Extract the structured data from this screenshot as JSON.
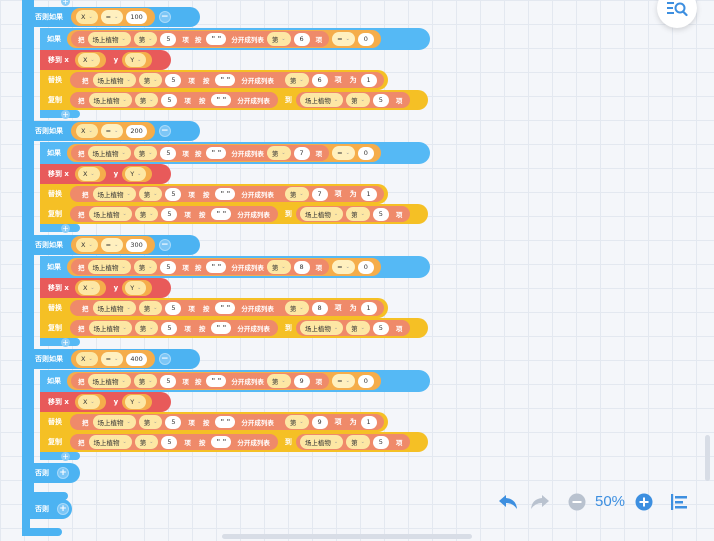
{
  "labels": {
    "else_if": "否则如果",
    "if": "如果",
    "move_to_x": "移到 x",
    "y": "y",
    "replace": "替换",
    "copy": "复制",
    "else": "否则",
    "take": "把",
    "item_word": "项",
    "split_by": "按",
    "split_into_list": "分开成列表",
    "nth": "第",
    "to": "为",
    "to_position": "到",
    "quote": "\" \""
  },
  "vars": {
    "x": "X",
    "y": "Y",
    "plants": "场上植物"
  },
  "operators": {
    "eq": "="
  },
  "values": {
    "five": "5",
    "zero": "0",
    "one": "1"
  },
  "branches": [
    {
      "x_value": "100",
      "item_index": "6"
    },
    {
      "x_value": "200",
      "item_index": "7"
    },
    {
      "x_value": "300",
      "item_index": "8"
    },
    {
      "x_value": "400",
      "item_index": "9"
    }
  ],
  "toolbar": {
    "zoom": "50%"
  },
  "colors": {
    "control": "#4cb3f2",
    "move": "#e85a5a",
    "data": "#f5c025",
    "operator": "#f5ad4b",
    "list": "#ef8a6a",
    "toolbar_accent": "#3d8fe0"
  }
}
